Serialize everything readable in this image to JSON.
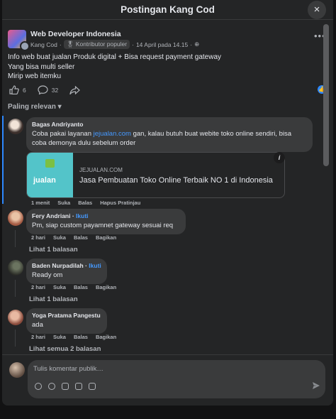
{
  "dialog": {
    "title": "Postingan Kang Cod",
    "close_icon": "×"
  },
  "post": {
    "group": "Web Developer Indonesia",
    "author": "Kang Cod",
    "badge": "Kontributor populer",
    "date": "14 April pada 14.15",
    "more_icon": "•••",
    "lines": [
      "Info web buat jualan Produk digital + Bisa request payment gateway",
      "Yang bisa multi seller",
      "Mirip web itemku"
    ],
    "like_count": "6",
    "comment_count": "32"
  },
  "sort_label": "Paling relevan",
  "comments": [
    {
      "name": "Bagas Andriyanto",
      "text_before": "Coba pakai layanan ",
      "link_text": "jejualan.com",
      "text_after": " gan, kalau butuh buat webite toko online sendiri, bisa coba demonya dulu sebelum order",
      "time": "1 menit",
      "like": "Suka",
      "reply": "Balas",
      "extra": "Hapus Pratinjau"
    },
    {
      "name": "Fery Andriani",
      "follow": "Ikuti",
      "text": "Pm, siap custom payamnet gateway sesuai req",
      "time": "2 hari",
      "like": "Suka",
      "reply": "Balas",
      "share": "Bagikan",
      "replies": "Lihat 1 balasan"
    },
    {
      "name": "Baden Nurpadilah",
      "follow": "Ikuti",
      "text": "Ready om",
      "time": "2 hari",
      "like": "Suka",
      "reply": "Balas",
      "share": "Bagikan",
      "replies": "Lihat 1 balasan"
    },
    {
      "name": "Yoga Pratama Pangestu",
      "text": "ada",
      "time": "2 hari",
      "like": "Suka",
      "reply": "Balas",
      "share": "Bagikan",
      "replies": "Lihat semua 2 balasan"
    }
  ],
  "link_preview": {
    "domain": "JEJUALAN.COM",
    "title": "Jasa Pembuatan Toko Online Terbaik NO 1 di Indonesia",
    "logo_text": "jualan",
    "info_icon": "i"
  },
  "composer": {
    "placeholder": "Tulis komentar publik…"
  },
  "colors": {
    "background": "#242526",
    "bubble": "#3a3b3c",
    "link": "#4599ff",
    "accent_bar": "#2d88ff"
  }
}
